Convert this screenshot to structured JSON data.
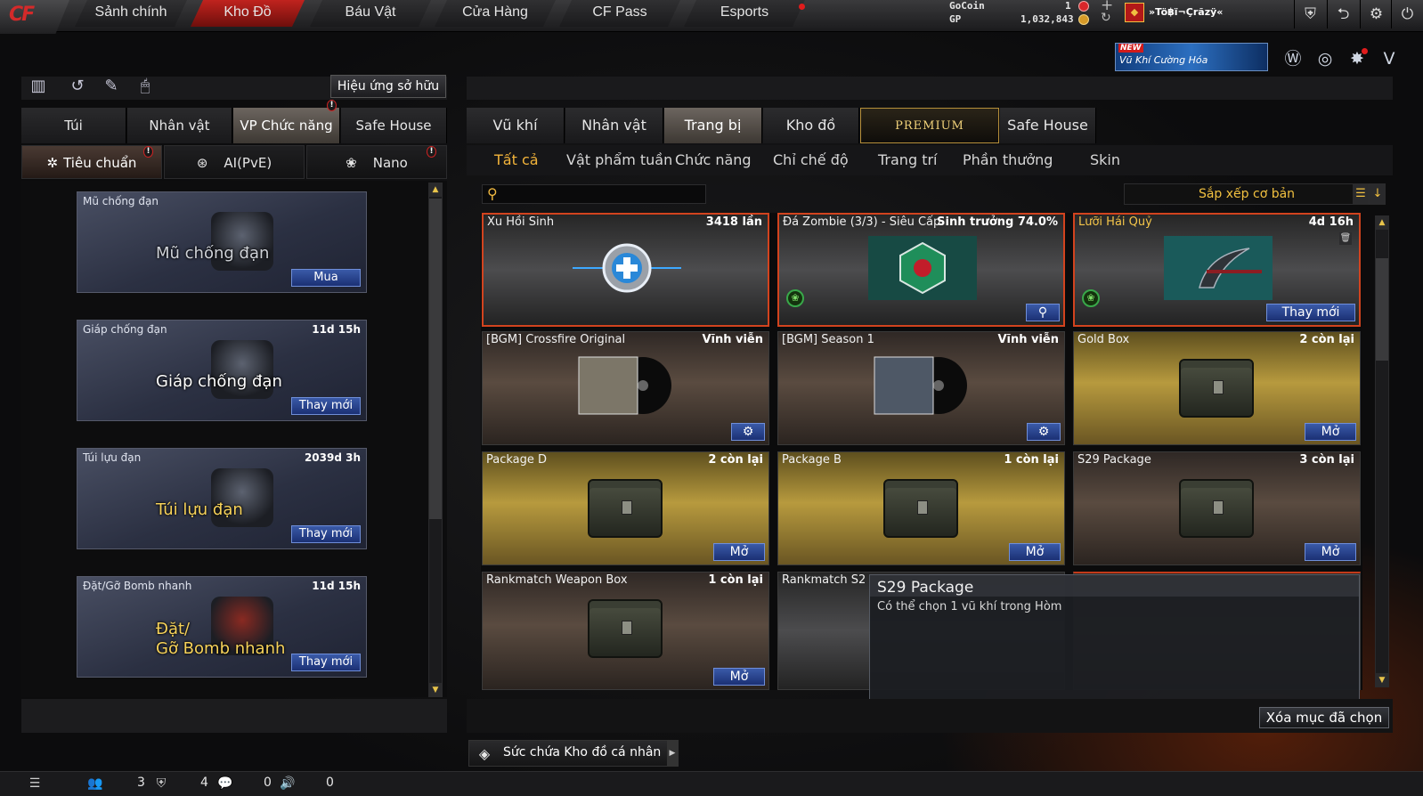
{
  "nav": {
    "logo": "CF",
    "tabs": [
      {
        "label": "Sảnh chính"
      },
      {
        "label": "Kho Đồ"
      },
      {
        "label": "Báu Vật"
      },
      {
        "label": "Cửa Hàng"
      },
      {
        "label": "CF Pass"
      },
      {
        "label": "Esports"
      }
    ],
    "active_tab": "Kho Đồ"
  },
  "currency": {
    "gocoin_label": "GoCoin",
    "gocoin_value": "1",
    "gp_label": "GP",
    "gp_value": "1,032,843"
  },
  "player": {
    "name": "»Tö฿ï¬Çrãzÿ«",
    "badge": "◆"
  },
  "promo_banner": {
    "new_tag": "NEW",
    "text": "Vũ Khí Cường Hóa"
  },
  "left_panel": {
    "effect_button": "Hiệu ứng sở hữu",
    "tabs": [
      "Túi",
      "Nhân vật",
      "VP Chức năng",
      "Safe House"
    ],
    "active_tab": "VP Chức năng",
    "subtabs": [
      "Tiêu chuẩn",
      "AI(PvE)",
      "Nano"
    ],
    "active_subtab": "Tiêu chuẩn",
    "items": [
      {
        "name": "Mũ chống đạn",
        "time": "",
        "art_text": "Mũ chống đạn",
        "button": "Mua"
      },
      {
        "name": "Giáp chống đạn",
        "time": "11d 15h",
        "art_text": "Giáp chống đạn",
        "button": "Thay mới"
      },
      {
        "name": "Túi lựu đạn",
        "time": "2039d 3h",
        "art_text": "Túi lựu đạn",
        "button": "Thay mới"
      },
      {
        "name": "Đặt/Gỡ Bomb nhanh",
        "time": "11d 15h",
        "art_text_1": "Đặt/",
        "art_text_2": "Gỡ Bomb nhanh",
        "button": "Thay mới"
      }
    ]
  },
  "right_panel": {
    "tabs": [
      "Vũ khí",
      "Nhân vật",
      "Trang bị",
      "Kho đồ",
      "PREMIUM",
      "Safe House"
    ],
    "active_tab": "Trang bị",
    "subtabs": [
      "Tất cả",
      "Vật phẩm tuần",
      "Chức năng",
      "Chỉ chế độ",
      "Trang trí",
      "Phần thưởng",
      "Skin"
    ],
    "active_subtab": "Tất cả",
    "search_placeholder": "",
    "sort_label": "Sắp xếp cơ bản",
    "items": [
      {
        "name": "Xu Hồi Sinh",
        "meta": "3418 lần",
        "button": ""
      },
      {
        "name": "Đá Zombie (3/3) - Siêu Cấp",
        "meta": "Sinh trưởng 74.0%",
        "button": "search-icon"
      },
      {
        "name": "Lưỡi Hái Quỷ",
        "meta": "4d 16h",
        "button": "Thay mới"
      },
      {
        "name": "[BGM] Crossfire Original",
        "meta": "Vĩnh viễn",
        "button": "gear-icon"
      },
      {
        "name": "[BGM] Season 1",
        "meta": "Vĩnh viễn",
        "button": "gear-icon"
      },
      {
        "name": "Gold Box",
        "meta": "2 còn lại",
        "button": "Mở"
      },
      {
        "name": "Package D",
        "meta": "2 còn lại",
        "button": "Mở"
      },
      {
        "name": "Package B",
        "meta": "1 còn lại",
        "button": "Mở"
      },
      {
        "name": "S29 Package",
        "meta": "3 còn lại",
        "button": "Mở"
      },
      {
        "name": "Rankmatch Weapon Box",
        "meta": "1 còn lại",
        "button": "Mở"
      },
      {
        "name": "Rankmatch S2",
        "meta": "",
        "button": ""
      }
    ],
    "tooltip": {
      "title": "S29 Package",
      "desc": "Có thể chọn 1 vũ khí trong Hòm"
    },
    "delete_button": "Xóa mục đã chọn",
    "storage_label": "Sức chứa Kho đồ cá nhân"
  },
  "status_bar": {
    "friends": "3",
    "clan": "4",
    "chat": "0",
    "voice": "0"
  },
  "colors": {
    "accent_red": "#c0231e",
    "accent_gold": "#f3b43a",
    "button_blue": "#2b4a98"
  }
}
